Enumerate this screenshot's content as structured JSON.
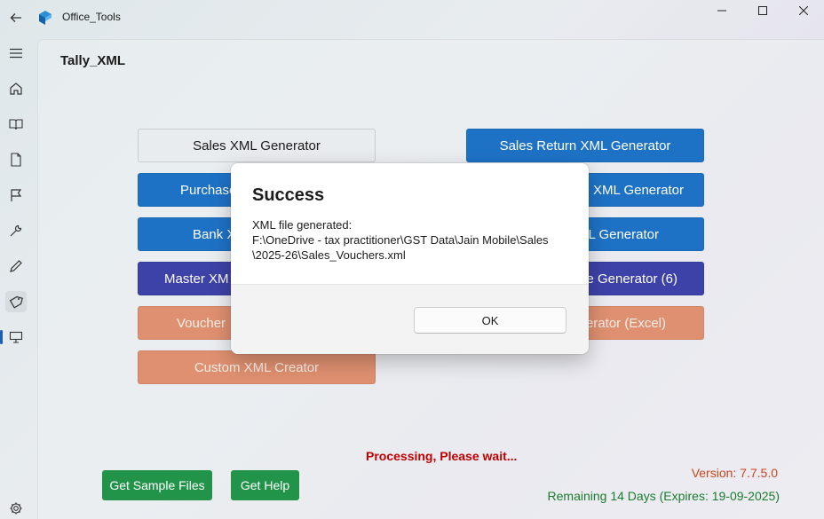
{
  "app": {
    "title": "Office_Tools"
  },
  "icons": {
    "back": "back-arrow-icon",
    "logo": "app-logo-icon",
    "minimize": "minimize-icon",
    "maximize": "maximize-icon",
    "close": "close-icon",
    "menu": "hamburger-menu-icon",
    "settings": "gear-icon"
  },
  "sidebar": {
    "items": [
      {
        "name": "home",
        "icon": "home-icon"
      },
      {
        "name": "book",
        "icon": "book-icon"
      },
      {
        "name": "document",
        "icon": "document-icon"
      },
      {
        "name": "flag",
        "icon": "flag-icon"
      },
      {
        "name": "wrench",
        "icon": "wrench-icon"
      },
      {
        "name": "pen",
        "icon": "pen-icon"
      },
      {
        "name": "tag",
        "icon": "tag-icon",
        "active": true
      },
      {
        "name": "monitor",
        "icon": "monitor-icon"
      }
    ]
  },
  "page": {
    "title": "Tally_XML"
  },
  "buttons": {
    "sales": "Sales XML Generator",
    "sales_return": "Sales Return XML Generator",
    "purchase": "Purchase",
    "purchase_right": "XML Generator",
    "bank": "Bank X",
    "bank_right": "L Generator",
    "master": "Master XM",
    "master_right": "e Generator (6)",
    "voucher": "Voucher",
    "voucher_right": "erator (Excel)",
    "custom": "Custom XML Creator"
  },
  "status": {
    "processing": "Processing, Please wait...",
    "version": "Version: 7.7.5.0",
    "remaining": "Remaining 14 Days (Expires: 19-09-2025)"
  },
  "actions": {
    "sample": "Get Sample Files",
    "help": "Get Help"
  },
  "dialog": {
    "title": "Success",
    "message": "XML file generated:\nF:\\OneDrive - tax practitioner\\GST Data\\Jain Mobile\\Sales\n\\2025-26\\Sales_Vouchers.xml",
    "ok": "OK"
  },
  "colors": {
    "blue": "#1e72c6",
    "indigo": "#3d42a8",
    "orange": "#df9070",
    "green": "#22944a",
    "processing": "#c00000",
    "version": "#c8471f",
    "remaining": "#1a7d2e"
  }
}
